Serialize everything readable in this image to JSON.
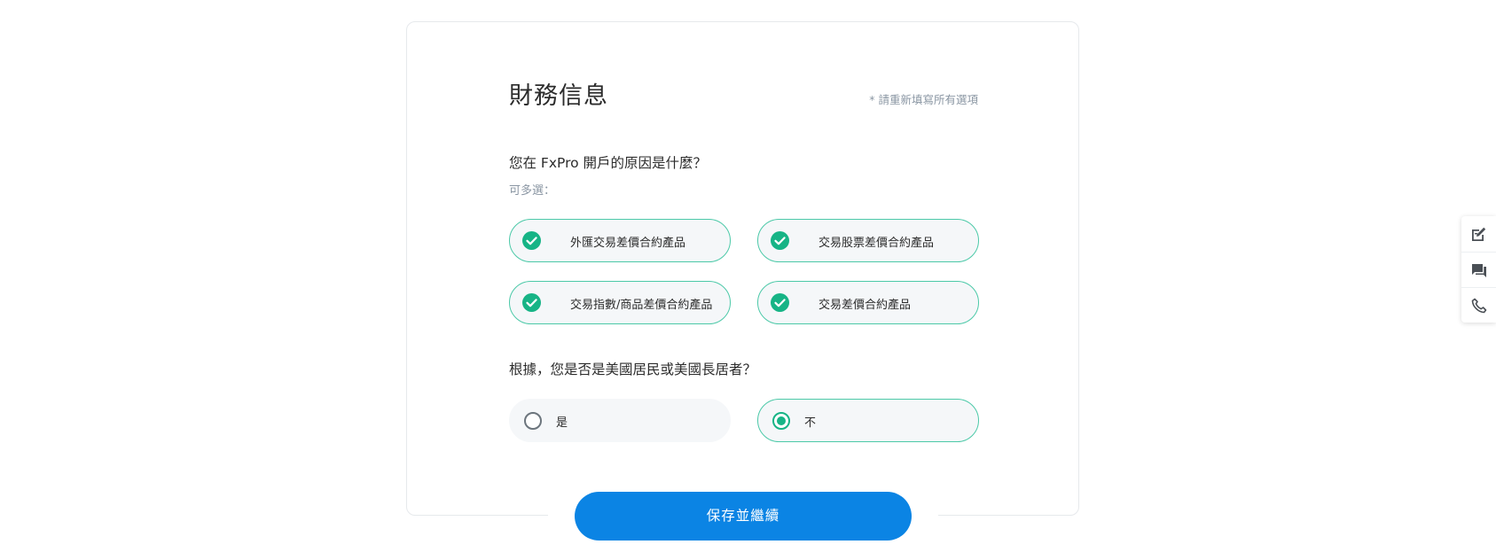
{
  "form": {
    "title": "財務信息",
    "required_note": "* 請重新填寫所有選項",
    "question1": {
      "text": "您在 FxPro 開戶的原因是什麼？",
      "hint": "可多選：",
      "options": [
        {
          "label": "外匯交易差價合約產品",
          "checked": true
        },
        {
          "label": "交易股票差價合約產品",
          "checked": true
        },
        {
          "label": "交易指數/商品差價合約產品",
          "checked": true
        },
        {
          "label": "交易差價合約產品",
          "checked": true
        }
      ]
    },
    "question2": {
      "text": "根據，您是否是美國居民或美國長居者？",
      "options": [
        {
          "label": "是",
          "selected": false
        },
        {
          "label": "不",
          "selected": true
        }
      ]
    },
    "save_label": "保存並繼續"
  },
  "side_widget": {
    "icons": [
      "edit-note-icon",
      "chat-icon",
      "phone-icon"
    ]
  },
  "colors": {
    "accent_green": "#17b486",
    "pill_border": "#4cc9a8",
    "button_blue": "#0b84e4",
    "muted_text": "#8a96a3"
  }
}
